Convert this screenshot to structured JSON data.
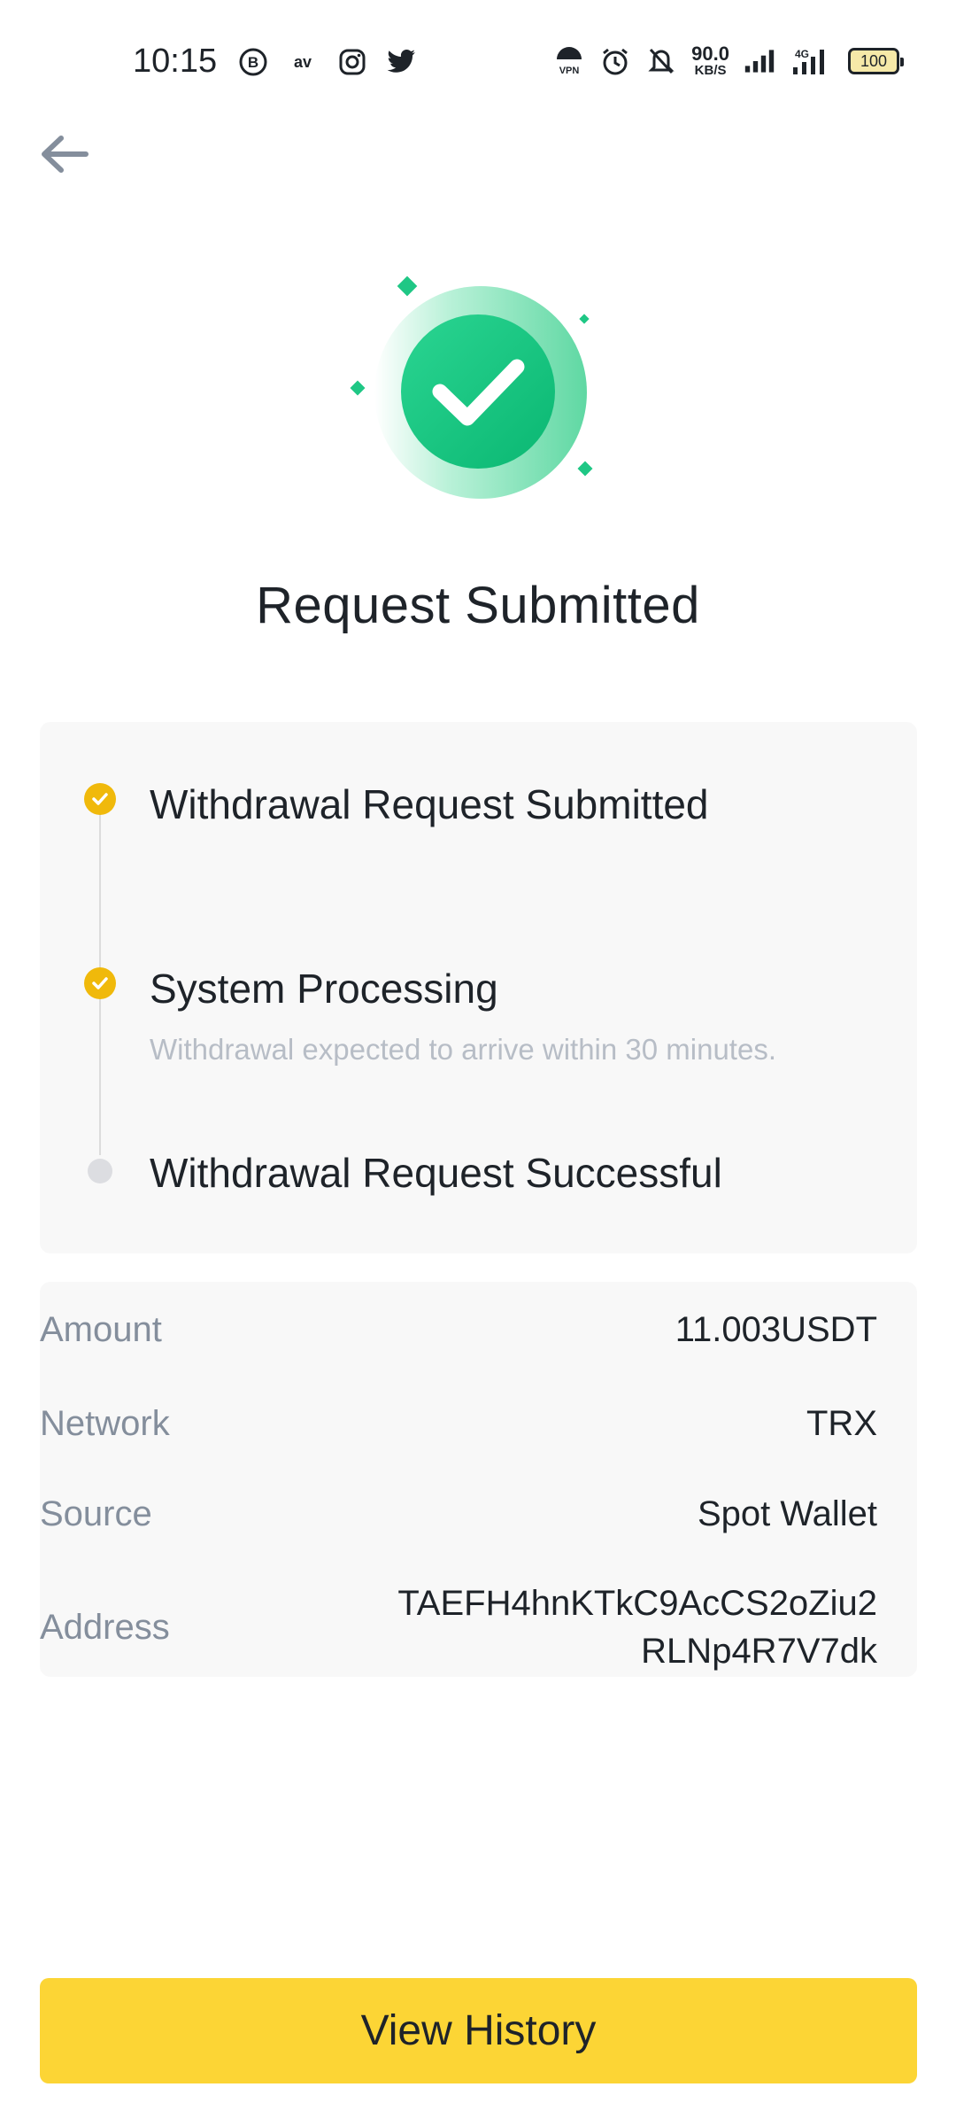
{
  "status_bar": {
    "time": "10:15",
    "speed_value": "90.0",
    "speed_unit": "KB/S",
    "network_label": "4G",
    "battery": "100"
  },
  "page": {
    "title": "Request Submitted"
  },
  "steps": [
    {
      "title": "Withdrawal Request Submitted",
      "subtitle": "",
      "status": "done"
    },
    {
      "title": "System Processing",
      "subtitle": "Withdrawal expected to arrive within 30 minutes.",
      "status": "done"
    },
    {
      "title": "Withdrawal Request Successful",
      "subtitle": "",
      "status": "pending"
    }
  ],
  "details": {
    "amount_label": "Amount",
    "amount_value": "11.003USDT",
    "network_label": "Network",
    "network_value": "TRX",
    "source_label": "Source",
    "source_value": "Spot Wallet",
    "address_label": "Address",
    "address_value": "TAEFH4hnKTkC9AcCS2oZiu2RLNp4R7V7dk"
  },
  "actions": {
    "view_history_label": "View History"
  },
  "colors": {
    "accent": "#fcd535",
    "step_done": "#f0b90b",
    "success_green": "#0ecb81"
  }
}
